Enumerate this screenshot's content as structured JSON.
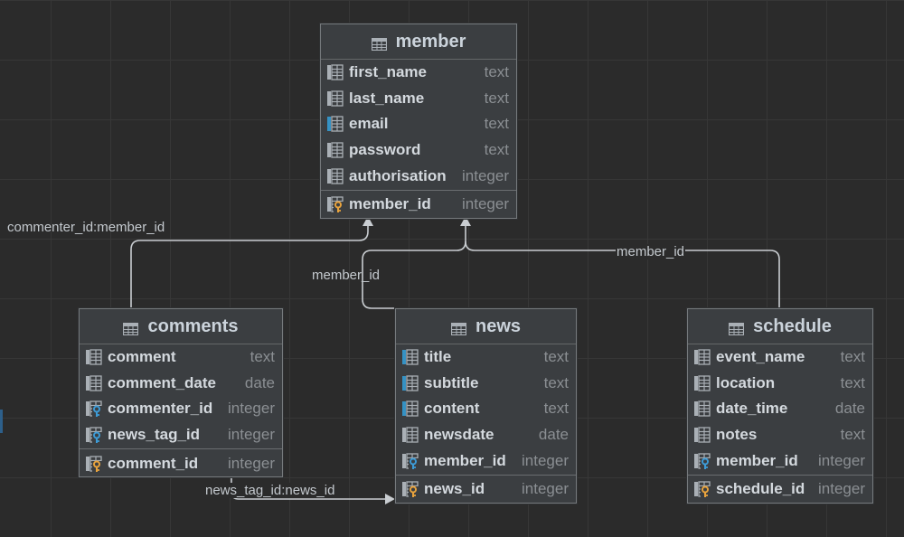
{
  "tables": [
    {
      "name": "member",
      "columns": [
        {
          "name": "first_name",
          "type": "text",
          "kind": "column"
        },
        {
          "name": "last_name",
          "type": "text",
          "kind": "column"
        },
        {
          "name": "email",
          "type": "text",
          "kind": "unique-column"
        },
        {
          "name": "password",
          "type": "text",
          "kind": "column"
        },
        {
          "name": "authorisation",
          "type": "integer",
          "kind": "column"
        }
      ],
      "keys": [
        {
          "name": "member_id",
          "type": "integer",
          "kind": "primary-key"
        }
      ]
    },
    {
      "name": "comments",
      "columns": [
        {
          "name": "comment",
          "type": "text",
          "kind": "column"
        },
        {
          "name": "comment_date",
          "type": "date",
          "kind": "column"
        },
        {
          "name": "commenter_id",
          "type": "integer",
          "kind": "foreign-key"
        },
        {
          "name": "news_tag_id",
          "type": "integer",
          "kind": "foreign-key"
        }
      ],
      "keys": [
        {
          "name": "comment_id",
          "type": "integer",
          "kind": "primary-key"
        }
      ]
    },
    {
      "name": "news",
      "columns": [
        {
          "name": "title",
          "type": "text",
          "kind": "unique-column"
        },
        {
          "name": "subtitle",
          "type": "text",
          "kind": "unique-column"
        },
        {
          "name": "content",
          "type": "text",
          "kind": "unique-column"
        },
        {
          "name": "newsdate",
          "type": "date",
          "kind": "column"
        },
        {
          "name": "member_id",
          "type": "integer",
          "kind": "foreign-key"
        }
      ],
      "keys": [
        {
          "name": "news_id",
          "type": "integer",
          "kind": "primary-key"
        }
      ]
    },
    {
      "name": "schedule",
      "columns": [
        {
          "name": "event_name",
          "type": "text",
          "kind": "column"
        },
        {
          "name": "location",
          "type": "text",
          "kind": "column"
        },
        {
          "name": "date_time",
          "type": "date",
          "kind": "column"
        },
        {
          "name": "notes",
          "type": "text",
          "kind": "column"
        },
        {
          "name": "member_id",
          "type": "integer",
          "kind": "foreign-key"
        }
      ],
      "keys": [
        {
          "name": "schedule_id",
          "type": "integer",
          "kind": "primary-key"
        }
      ]
    }
  ],
  "relationships": [
    {
      "from": "comments",
      "to": "member",
      "label": "commenter_id:member_id"
    },
    {
      "from": "news",
      "to": "member",
      "label": "member_id"
    },
    {
      "from": "schedule",
      "to": "member",
      "label": "member_id"
    },
    {
      "from": "comments",
      "to": "news",
      "label": "news_tag_id:news_id"
    }
  ],
  "colors": {
    "background": "#2b2b2b",
    "grid": "#373737",
    "table_bg": "#3b3e41",
    "table_border": "#75797c",
    "line": "#c9cdd1",
    "column_icon": "#aab0b6",
    "unique_accent": "#3592c4",
    "fk_key": "#3d9bd6",
    "pk_key": "#e8a33d"
  },
  "icons": {
    "table": "table-icon",
    "column": "column-icon",
    "unique-column": "unique-column-icon",
    "foreign-key": "foreign-key-icon",
    "primary-key": "primary-key-icon"
  }
}
